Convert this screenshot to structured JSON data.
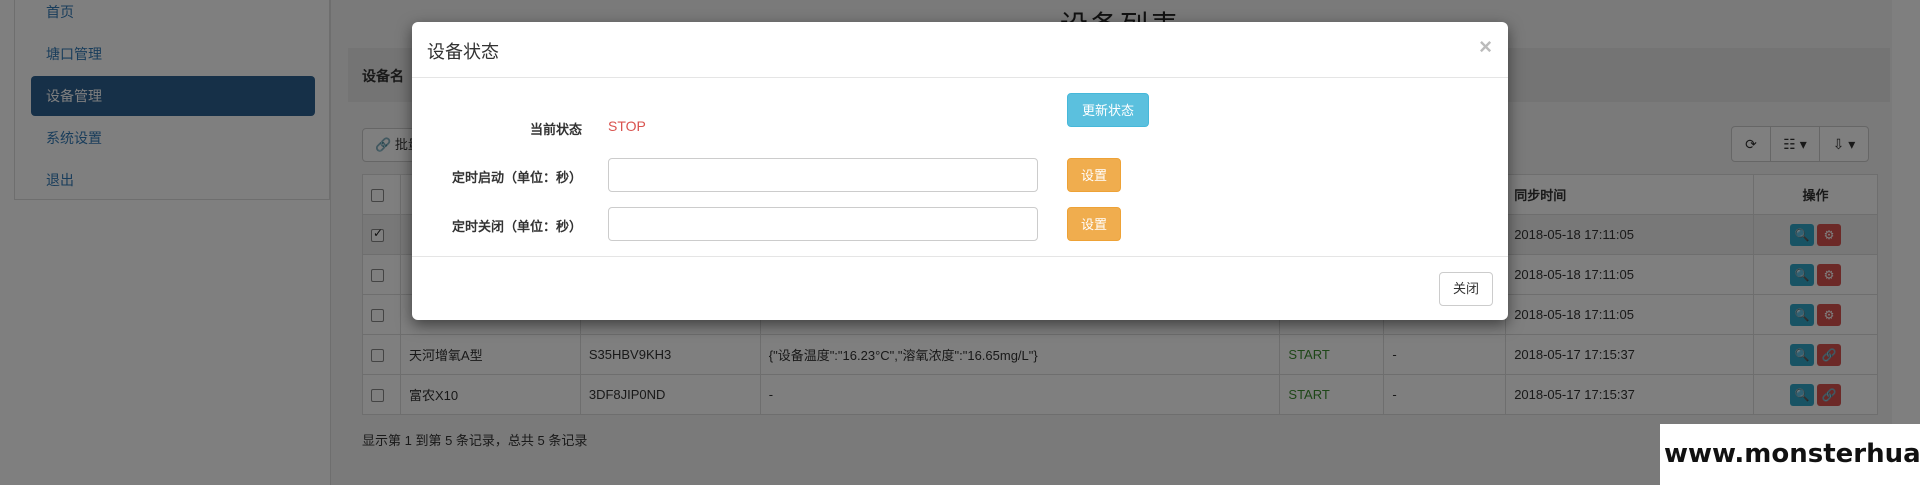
{
  "sidebar": {
    "items": [
      {
        "label": "首页",
        "active": false
      },
      {
        "label": "塘口管理",
        "active": false
      },
      {
        "label": "设备管理",
        "active": true
      },
      {
        "label": "系统设置",
        "active": false
      },
      {
        "label": "退出",
        "active": false
      }
    ]
  },
  "page": {
    "title": "设备列表",
    "filter_label": "设备名",
    "batch_label": "批量",
    "footer": "显示第 1 到第 5 条记录，总共 5 条记录"
  },
  "table": {
    "headers": {
      "sync_time": "同步时间",
      "actions": "操作"
    },
    "rows": [
      {
        "checked": true,
        "name": "",
        "code": "",
        "data": "",
        "status": "",
        "extra": "",
        "time": "2018-05-18 17:11:05"
      },
      {
        "checked": false,
        "name": "",
        "code": "",
        "data": "",
        "status": "",
        "extra": "",
        "time": "2018-05-18 17:11:05"
      },
      {
        "checked": false,
        "name": "",
        "code": "",
        "data": "",
        "status": "",
        "extra": "",
        "time": "2018-05-18 17:11:05"
      },
      {
        "checked": false,
        "name": "天河增氧A型",
        "code": "S35HBV9KH3",
        "data": "{\"设备温度\":\"16.23°C\",\"溶氧浓度\":\"16.65mg/L\"}",
        "status": "START",
        "extra": "-",
        "time": "2018-05-17 17:15:37"
      },
      {
        "checked": false,
        "name": "富农X10",
        "code": "3DF8JIP0ND",
        "data": "-",
        "status": "START",
        "extra": "-",
        "time": "2018-05-17 17:15:37"
      }
    ]
  },
  "modal": {
    "title": "设备状态",
    "close_symbol": "×",
    "current_status_label": "当前状态",
    "current_status_value": "STOP",
    "update_status_button": "更新状态",
    "timed_start_label": "定时启动（单位：秒）",
    "timed_start_value": "",
    "timed_stop_label": "定时关闭（单位：秒）",
    "timed_stop_value": "",
    "set_button": "设置",
    "close_button": "关闭"
  },
  "colors": {
    "status_stop": "#d9534f",
    "status_start": "#3c8d2f",
    "sidebar_active": "#2c6090",
    "info_button": "#5bc0de",
    "warning_button": "#f0ad4e"
  },
  "icons": {
    "refresh": "refresh-icon",
    "columns": "columns-icon",
    "export": "export-icon",
    "view": "search-icon",
    "control": "control-icon",
    "link": "link-icon"
  },
  "watermark": "www.monsterhua.com"
}
